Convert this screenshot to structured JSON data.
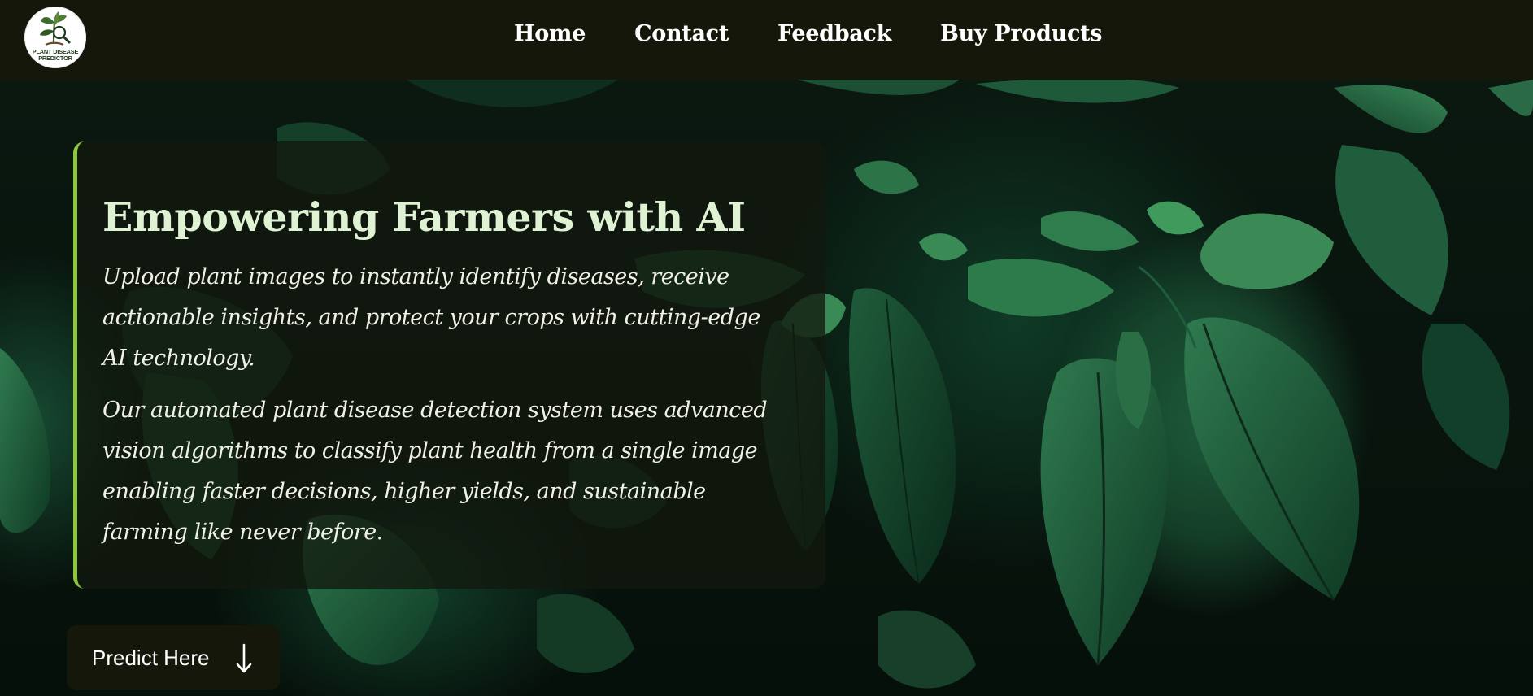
{
  "logo": {
    "line1": "PLANT DISEASE",
    "line2": "PREDICTOR",
    "icon": "plant-magnifier-icon"
  },
  "nav": {
    "items": [
      {
        "label": "Home"
      },
      {
        "label": "Contact"
      },
      {
        "label": "Feedback"
      },
      {
        "label": "Buy Products"
      }
    ]
  },
  "hero": {
    "title": "Empowering Farmers with AI",
    "paragraph1": "Upload plant images to instantly identify diseases, receive actionable insights, and protect your crops with cutting-edge AI technology.",
    "paragraph2": "Our automated plant disease detection system uses advanced vision algorithms to classify plant health from a single image enabling faster decisions, higher yields, and sustainable farming like never before.",
    "background": "dark-green-leaves-photo"
  },
  "cta": {
    "label": "Predict Here",
    "icon": "arrow-down-icon"
  },
  "colors": {
    "nav_bg": "#15170b",
    "accent": "#8dc63f",
    "title": "#e0f2d4",
    "text": "#f0f0e6"
  }
}
